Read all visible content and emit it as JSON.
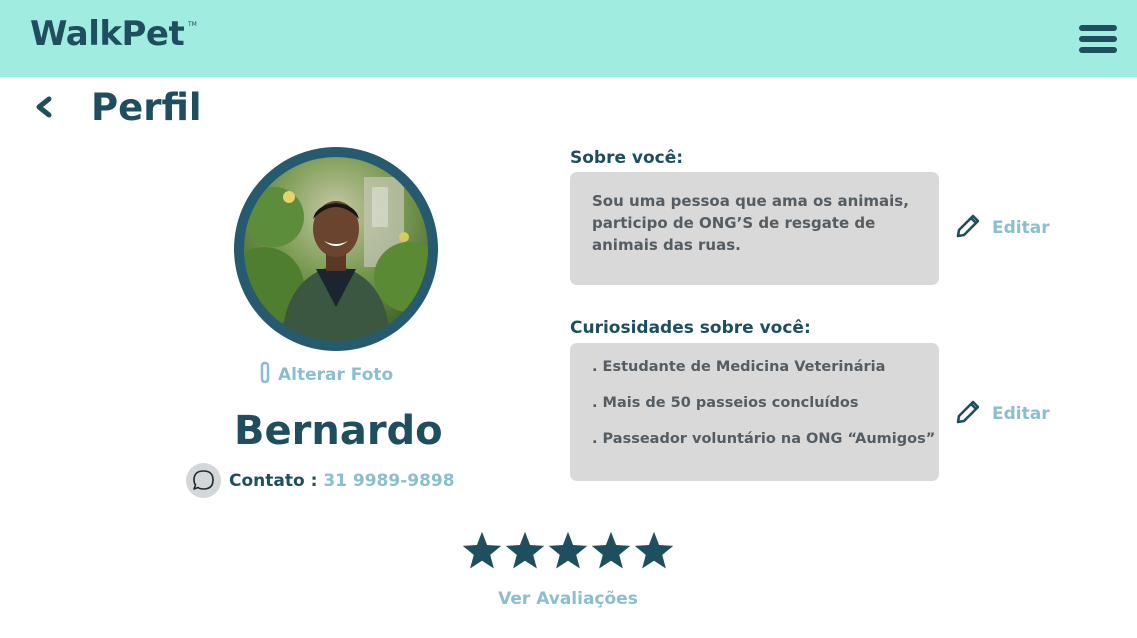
{
  "header": {
    "logo_text": "WalkPet",
    "logo_tm": "TM",
    "menu_icon": "hamburger-menu-icon"
  },
  "page": {
    "title": "Perfil",
    "back_icon": "chevron-left-icon"
  },
  "profile": {
    "alter_foto_label": "Alterar Foto",
    "alter_foto_icon": "paperclip-icon",
    "name": "Bernardo",
    "contact_label": "Contato :",
    "contact_value": "31 9989-9898",
    "chat_icon": "chat-bubble-icon"
  },
  "about": {
    "label": "Sobre você:",
    "text": "Sou uma pessoa que ama os animais, participo de ONG’S de resgate de animais das ruas.",
    "edit_label": "Editar",
    "edit_icon": "pencil-icon"
  },
  "curiosities": {
    "label": "Curiosidades sobre você:",
    "items": [
      ". Estudante de Medicina Veterinária",
      ". Mais de 50 passeios concluídos",
      ". Passeador voluntário na ONG “Aumigos”"
    ],
    "edit_label": "Editar",
    "edit_icon": "pencil-icon"
  },
  "rating": {
    "stars": 5,
    "max_stars": 5,
    "link_label": "Ver Avaliações"
  },
  "colors": {
    "header_bg": "#a1ece0",
    "primary": "#1f4e5f",
    "accent": "#89bfcf",
    "box_bg": "#d9d9d9"
  }
}
